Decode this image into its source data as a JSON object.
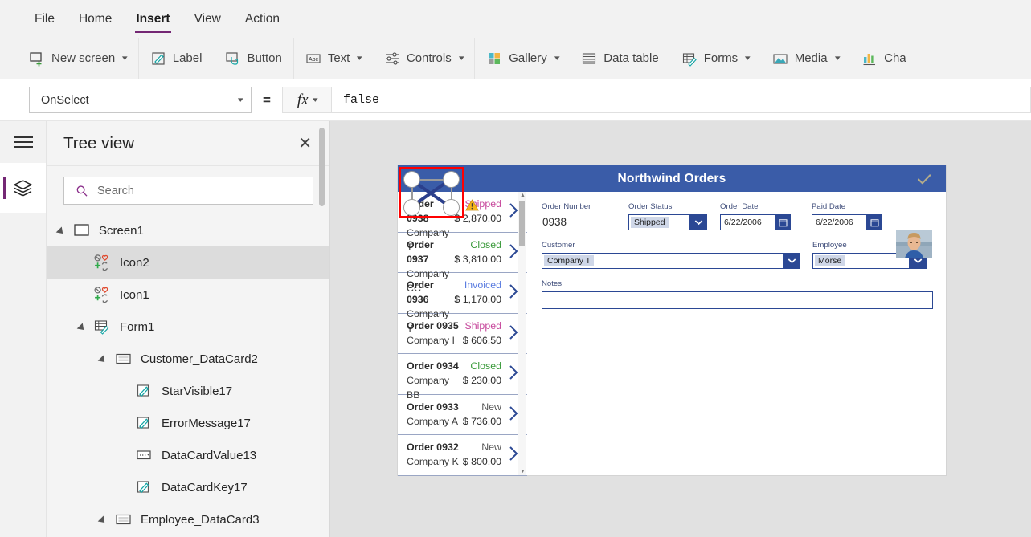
{
  "menubar": {
    "items": [
      {
        "label": "File",
        "active": false
      },
      {
        "label": "Home",
        "active": false
      },
      {
        "label": "Insert",
        "active": true
      },
      {
        "label": "View",
        "active": false
      },
      {
        "label": "Action",
        "active": false
      }
    ]
  },
  "ribbon": {
    "buttons": [
      {
        "label": "New screen",
        "icon": "new-screen-icon",
        "caret": true
      },
      {
        "label": "Label",
        "icon": "label-icon",
        "caret": false
      },
      {
        "label": "Button",
        "icon": "button-icon",
        "caret": false
      },
      {
        "label": "Text",
        "icon": "text-abc-icon",
        "caret": true
      },
      {
        "label": "Controls",
        "icon": "controls-sliders-icon",
        "caret": true
      },
      {
        "label": "Gallery",
        "icon": "gallery-grid-icon",
        "caret": true
      },
      {
        "label": "Data table",
        "icon": "data-table-icon",
        "caret": false
      },
      {
        "label": "Forms",
        "icon": "forms-icon",
        "caret": true
      },
      {
        "label": "Media",
        "icon": "media-image-icon",
        "caret": true
      },
      {
        "label": "Cha",
        "icon": "charts-bar-icon",
        "caret": false
      }
    ]
  },
  "formula_bar": {
    "property": "OnSelect",
    "equals": "=",
    "fx_label": "fx",
    "value": "false"
  },
  "rail": {
    "hamburger": "hamburger-icon",
    "items": [
      {
        "icon": "layers-icon",
        "active": true
      }
    ]
  },
  "tree_view": {
    "title": "Tree view",
    "close": "✕",
    "search_placeholder": "Search",
    "search_value": "",
    "nodes": [
      {
        "label": "Screen1",
        "depth": 0,
        "icon": "screen-icon",
        "twisty": "expanded",
        "selected": false
      },
      {
        "label": "Icon2",
        "depth": 1,
        "icon": "icon-set-icon",
        "twisty": "none",
        "selected": true
      },
      {
        "label": "Icon1",
        "depth": 1,
        "icon": "icon-set-icon",
        "twisty": "none",
        "selected": false
      },
      {
        "label": "Form1",
        "depth": 1,
        "icon": "form-icon",
        "twisty": "expanded",
        "selected": false
      },
      {
        "label": "Customer_DataCard2",
        "depth": 2,
        "icon": "datacard-icon",
        "twisty": "expanded",
        "selected": false
      },
      {
        "label": "StarVisible17",
        "depth": 3,
        "icon": "label-pencil-icon",
        "twisty": "none",
        "selected": false
      },
      {
        "label": "ErrorMessage17",
        "depth": 3,
        "icon": "label-pencil-icon",
        "twisty": "none",
        "selected": false
      },
      {
        "label": "DataCardValue13",
        "depth": 3,
        "icon": "dropdown-icon",
        "twisty": "none",
        "selected": false
      },
      {
        "label": "DataCardKey17",
        "depth": 3,
        "icon": "label-pencil-icon",
        "twisty": "none",
        "selected": false
      },
      {
        "label": "Employee_DataCard3",
        "depth": 2,
        "icon": "datacard-icon",
        "twisty": "expanded",
        "selected": false
      }
    ]
  },
  "app": {
    "header_title": "Northwind Orders",
    "header_check": "check-icon",
    "header_bg": "#3a5ca8",
    "gallery": [
      {
        "order": "Order 0938",
        "company": "Company T",
        "status": "Shipped",
        "status_color": "#c7489c",
        "amount": "$ 2,870.00",
        "warning": true
      },
      {
        "order": "Order 0937",
        "company": "Company CC",
        "status": "Closed",
        "status_color": "#3a9a3a",
        "amount": "$ 3,810.00",
        "warning": false
      },
      {
        "order": "Order 0936",
        "company": "Company Y",
        "status": "Invoiced",
        "status_color": "#5a7ce0",
        "amount": "$ 1,170.00",
        "warning": false
      },
      {
        "order": "Order 0935",
        "company": "Company I",
        "status": "Shipped",
        "status_color": "#c7489c",
        "amount": "$ 606.50",
        "warning": false
      },
      {
        "order": "Order 0934",
        "company": "Company BB",
        "status": "Closed",
        "status_color": "#3a9a3a",
        "amount": "$ 230.00",
        "warning": false
      },
      {
        "order": "Order 0933",
        "company": "Company A",
        "status": "New",
        "status_color": "#555555",
        "amount": "$ 736.00",
        "warning": false
      },
      {
        "order": "Order 0932",
        "company": "Company K",
        "status": "New",
        "status_color": "#555555",
        "amount": "$ 800.00",
        "warning": false
      }
    ],
    "form": {
      "order_number_label": "Order Number",
      "order_number_value": "0938",
      "order_status_label": "Order Status",
      "order_status_value": "Shipped",
      "order_date_label": "Order Date",
      "order_date_value": "6/22/2006",
      "paid_date_label": "Paid Date",
      "paid_date_value": "6/22/2006",
      "customer_label": "Customer",
      "customer_value": "Company T",
      "employee_label": "Employee",
      "employee_value": "Morse",
      "notes_label": "Notes",
      "notes_value": ""
    }
  },
  "selection": {
    "border_color": "#ff0000",
    "handle_color": "#ffffff",
    "cross_color": "#2b3f8c"
  }
}
